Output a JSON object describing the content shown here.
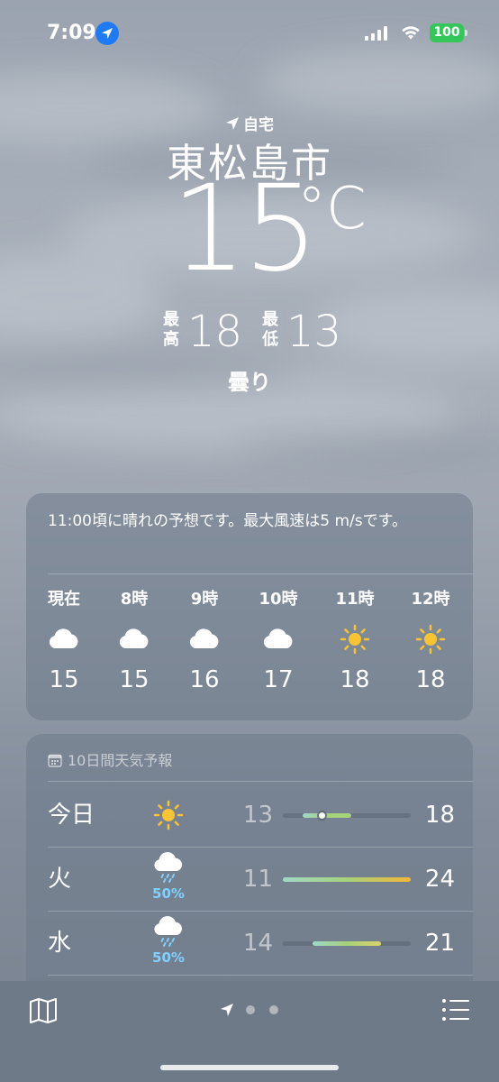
{
  "status_bar": {
    "time": "7:09",
    "battery": "100",
    "location_icon": "location-arrow-icon",
    "signal_icon": "cellular-signal-icon",
    "wifi_icon": "wifi-icon"
  },
  "header": {
    "home_label": "自宅",
    "city": "東松島市",
    "temperature": "15",
    "unit": "°C",
    "high_label": "最高",
    "high": "18",
    "low_label": "最低",
    "low": "13",
    "condition": "曇り"
  },
  "hourly": {
    "summary": "11:00頃に晴れの予想です。最大風速は5 m/sです。",
    "hours": [
      {
        "label": "現在",
        "icon": "cloud-icon",
        "temp": "15"
      },
      {
        "label": "8時",
        "icon": "cloud-icon",
        "temp": "15"
      },
      {
        "label": "9時",
        "icon": "cloud-icon",
        "temp": "16"
      },
      {
        "label": "10時",
        "icon": "cloud-icon",
        "temp": "17"
      },
      {
        "label": "11時",
        "icon": "sun-icon",
        "temp": "18"
      },
      {
        "label": "12時",
        "icon": "sun-icon",
        "temp": "18"
      }
    ]
  },
  "daily": {
    "title": "10日間天気予報",
    "title_icon": "calendar-icon",
    "days": [
      {
        "name": "今日",
        "icon": "sun-icon",
        "pop": "",
        "low": "13",
        "high": "18",
        "current": 15
      },
      {
        "name": "火",
        "icon": "cloud-rain-icon",
        "pop": "50%",
        "low": "11",
        "high": "24"
      },
      {
        "name": "水",
        "icon": "cloud-rain-icon",
        "pop": "50%",
        "low": "14",
        "high": "21"
      }
    ],
    "range": [
      11,
      24
    ]
  },
  "toolbar": {
    "map_icon": "map-icon",
    "list_icon": "list-icon",
    "page_count": 3,
    "current_page": 0
  },
  "colors": {
    "sun": "#f9c431",
    "precipitation": "#7fd0ff",
    "battery": "#33c759"
  }
}
